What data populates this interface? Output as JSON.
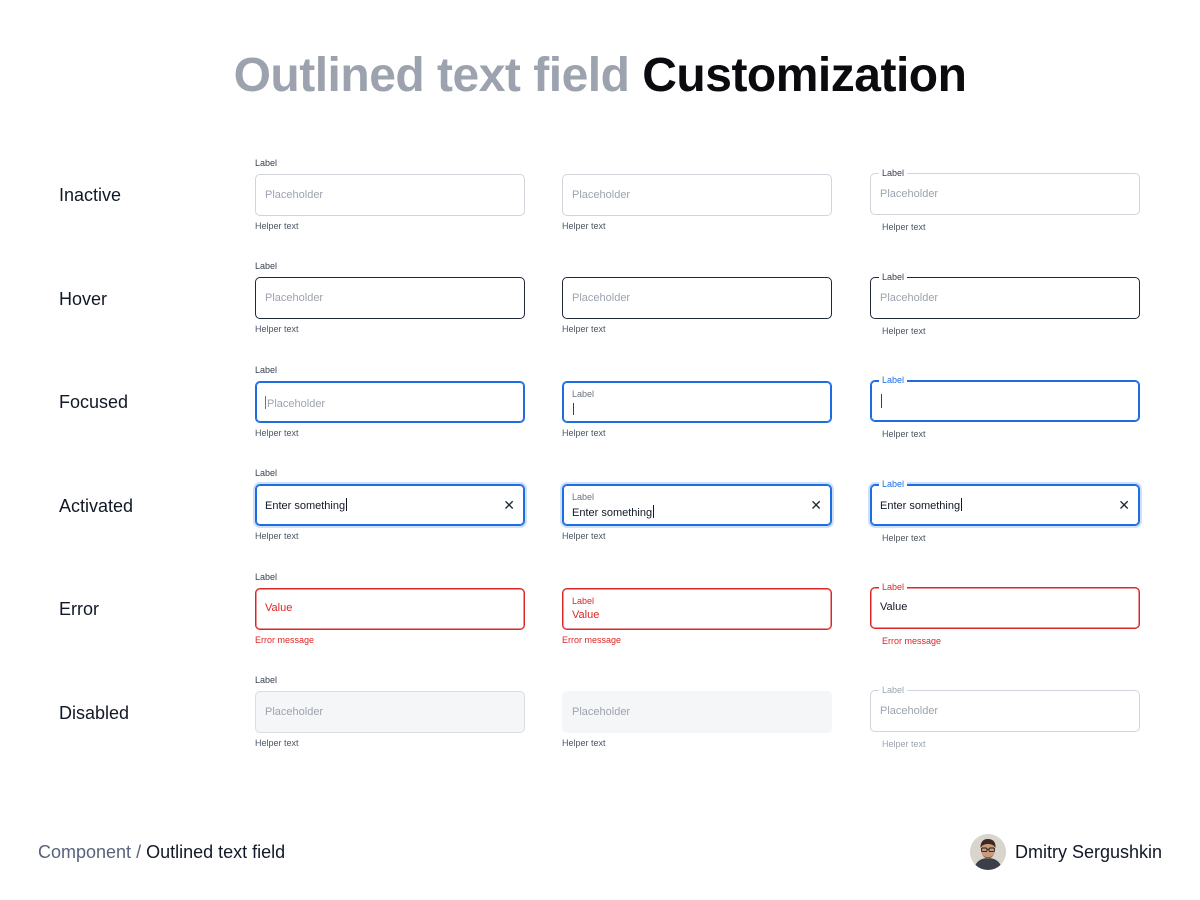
{
  "title": {
    "muted": "Outlined text field",
    "strong": "Customization"
  },
  "rows": {
    "inactive": "Inactive",
    "hover": "Hover",
    "focused": "Focused",
    "activated": "Activated",
    "error": "Error",
    "disabled": "Disabled"
  },
  "field": {
    "label": "Label",
    "placeholder": "Placeholder",
    "helper": "Helper text",
    "typed_value": "Enter something",
    "error_value": "Value",
    "error_message": "Error message",
    "clear_glyph": "✕"
  },
  "colors": {
    "accent": "#1d6de0",
    "error": "#dc2626",
    "border": "#d1d5db",
    "border_hover": "#1f2937",
    "disabled_bg": "#f5f6f8"
  },
  "footer": {
    "crumb_root": "Component",
    "crumb_separator": " / ",
    "crumb_current": "Outlined text field",
    "author": "Dmitry Sergushkin"
  }
}
